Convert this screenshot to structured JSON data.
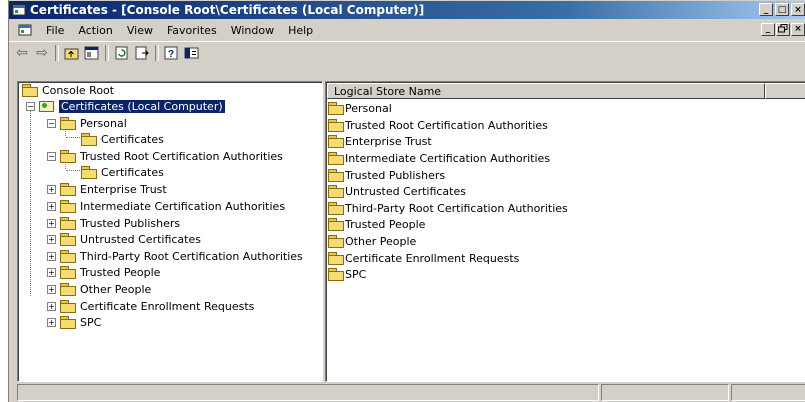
{
  "window": {
    "title": "Certificates - [Console Root\\Certificates (Local Computer)]",
    "caption_buttons": [
      "_",
      "□",
      "×"
    ],
    "mdi_buttons": [
      "_",
      "ð",
      "×"
    ]
  },
  "menu": {
    "items": [
      "File",
      "Action",
      "View",
      "Favorites",
      "Window",
      "Help"
    ]
  },
  "toolbar": {
    "buttons": [
      "back-icon",
      "forward-icon",
      "up-icon",
      "show-hide-tree-icon",
      "refresh-icon",
      "export-list-icon",
      "help-icon",
      "properties-icon"
    ],
    "back": "⇦",
    "forward": "⇨"
  },
  "tree": {
    "root": "Console Root",
    "computer": "Certificates (Local Computer)",
    "nodes": [
      {
        "label": "Personal",
        "expander": "−"
      },
      {
        "label": "Certificates",
        "expander": ""
      },
      {
        "label": "Trusted Root Certification Authorities",
        "expander": "−"
      },
      {
        "label": "Certificates",
        "expander": ""
      },
      {
        "label": "Enterprise Trust",
        "expander": "+"
      },
      {
        "label": "Intermediate Certification Authorities",
        "expander": "+"
      },
      {
        "label": "Trusted Publishers",
        "expander": "+"
      },
      {
        "label": "Untrusted Certificates",
        "expander": "+"
      },
      {
        "label": "Third-Party Root Certification Authorities",
        "expander": "+"
      },
      {
        "label": "Trusted People",
        "expander": "+"
      },
      {
        "label": "Other People",
        "expander": "+"
      },
      {
        "label": "Certificate Enrollment Requests",
        "expander": "+"
      },
      {
        "label": "SPC",
        "expander": "+"
      }
    ],
    "root_expander": "−"
  },
  "list": {
    "column_header": "Logical Store Name",
    "items": [
      "Personal",
      "Trusted Root Certification Authorities",
      "Enterprise Trust",
      "Intermediate Certification Authorities",
      "Trusted Publishers",
      "Untrusted Certificates",
      "Third-Party Root Certification Authorities",
      "Trusted People",
      "Other People",
      "Certificate Enrollment Requests",
      "SPC"
    ]
  },
  "colors": {
    "title_active": "#0a246a",
    "selection": "#0a246a",
    "face": "#d4d0c8",
    "folder": "#f4dc72"
  }
}
